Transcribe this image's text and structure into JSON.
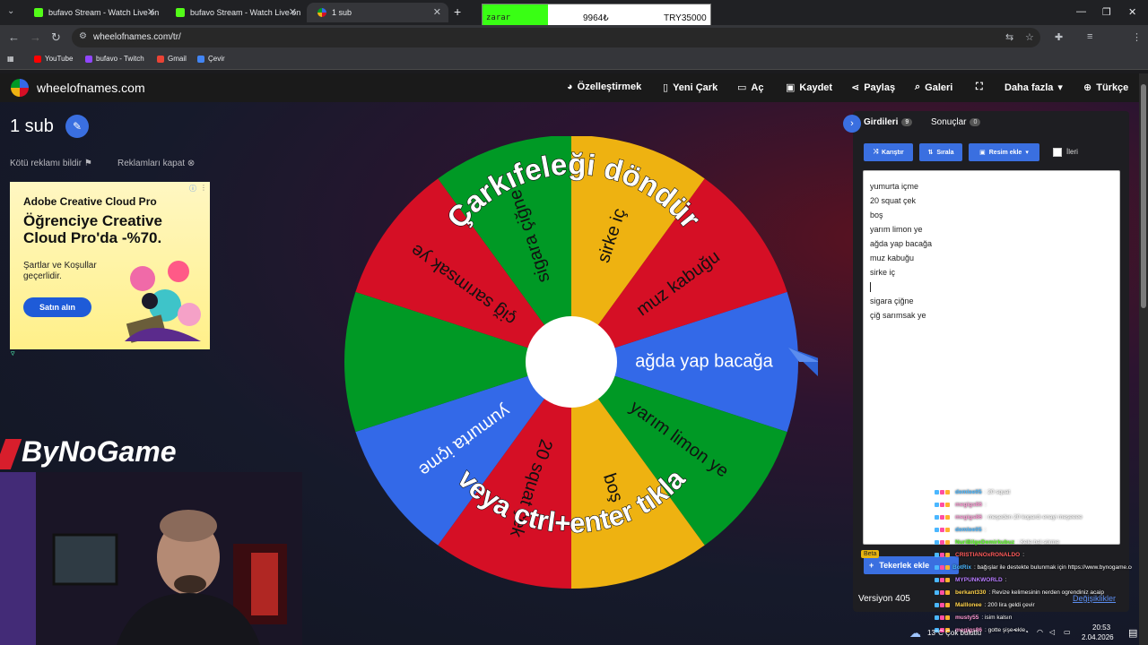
{
  "browser": {
    "tabs": [
      {
        "title": "bufavo Stream - Watch Live on",
        "color": "#53fc18"
      },
      {
        "title": "bufavo Stream - Watch Live on",
        "color": "#53fc18"
      },
      {
        "title": "1 sub",
        "color": "#e8453c",
        "active": true
      }
    ],
    "url": "wheelofnames.com/tr/",
    "bookmarks": [
      {
        "label": "YouTube",
        "color": "#ff0000"
      },
      {
        "label": "bufavo - Twitch",
        "color": "#9146ff"
      },
      {
        "label": "Gmail",
        "color": "#ea4335"
      },
      {
        "label": "Çevir",
        "color": "#4285f4"
      }
    ]
  },
  "stream_overlay": {
    "label": "zarar",
    "amount": "9964₺",
    "goal": "TRY35000"
  },
  "site": {
    "name": "wheelofnames.com",
    "nav": {
      "customize": "Özelleştirmek",
      "new": "Yeni Çark",
      "open": "Aç",
      "save": "Kaydet",
      "share": "Paylaş",
      "gallery": "Galeri",
      "more": "Daha fazla",
      "language": "Türkçe"
    }
  },
  "page": {
    "wheel_title": "1 sub",
    "report_ad": "Kötü reklamı bildir",
    "close_ads": "Reklamları kapat"
  },
  "ad": {
    "brand": "Adobe Creative Cloud Pro",
    "headline": "Öğrenciye Creative Cloud Pro'da -%70.",
    "terms": "Şartlar ve Koşullar geçerlidir.",
    "cta": "Satın alın"
  },
  "streamer_brand": "ByNoGame",
  "wheel": {
    "overlay_top": "Çarkıfeleği döndür",
    "overlay_bottom": "veya ctrl+enter tıkla",
    "segments": [
      {
        "label": "ağda yap bacağa",
        "color": "#3369e8"
      },
      {
        "label": "yarım limon ye",
        "color": "#009925"
      },
      {
        "label": "boş",
        "color": "#eeb211"
      },
      {
        "label": "20 squat çek",
        "color": "#d50f25"
      },
      {
        "label": "yumurta içme",
        "color": "#3369e8"
      },
      {
        "label": "",
        "color": "#009925"
      },
      {
        "label": "çiğ sarımsak ye",
        "color": "#d50f25"
      },
      {
        "label": "sigara çiğne",
        "color": "#009925"
      },
      {
        "label": "sirke iç",
        "color": "#eeb211"
      },
      {
        "label": "muz kabuğu",
        "color": "#d50f25"
      }
    ]
  },
  "panel": {
    "tab_entries": "Girdileri",
    "entries_count": "9",
    "tab_results": "Sonuçlar",
    "results_count": "0",
    "shuffle": "Karıştır",
    "sort": "Sırala",
    "add_image": "Resim ekle",
    "advanced": "İleri",
    "entries": [
      "yumurta içme",
      "20 squat çek",
      "boş",
      "yarım limon ye",
      "ağda yap bacağa",
      "muz kabuğu",
      "sirke iç",
      "",
      "sigara çiğne",
      "çiğ sarımsak ye"
    ],
    "beta": "Beta",
    "add_wheels": "Tekerlek ekle",
    "version": "Versiyon 405",
    "changes": "Değişiklikler"
  },
  "chat": [
    {
      "user": "demlee05",
      "color": "#4ab7ff",
      "msg": ": 20 squat"
    },
    {
      "user": "megigs86",
      "color": "#ff9ad5",
      "msg": ":"
    },
    {
      "user": "megigs86",
      "color": "#ff9ad5",
      "msg": ": meşeden 20 kopardı enayi meşeeee"
    },
    {
      "user": "demlee05",
      "color": "#4ab7ff",
      "msg": ":"
    },
    {
      "user": "NuriBilgeDemirkubuz",
      "color": "#53fc18",
      "msg": ": Kele bal sürme"
    },
    {
      "user": "CRISTIANOxRONALDO",
      "color": "#ff5a5a",
      "msg": ":"
    },
    {
      "user": "BotRix",
      "color": "#4ab7ff",
      "msg": ": bağışlar ile destekte bulunmak için https://www.bynogame.com/tr/destekle/bufavo"
    },
    {
      "user": "MYPUNKWORLD",
      "color": "#b77bff",
      "msg": ":"
    },
    {
      "user": "berkant330",
      "color": "#ffd24a",
      "msg": ": Revize kelimesinin nerden ogrendiniz acaip"
    },
    {
      "user": "Malllonee",
      "color": "#ffd24a",
      "msg": ": 200 lira geldi çevir"
    },
    {
      "user": "musty55",
      "color": "#ff9ad5",
      "msg": ": isim kalsın"
    },
    {
      "user": "megigs86",
      "color": "#ff9ad5",
      "msg": ": gotte şişe ekle"
    }
  ],
  "taskbar": {
    "weather": "13°C  Çok bulutlu",
    "time": "20:53",
    "date": "2.04.2026"
  }
}
